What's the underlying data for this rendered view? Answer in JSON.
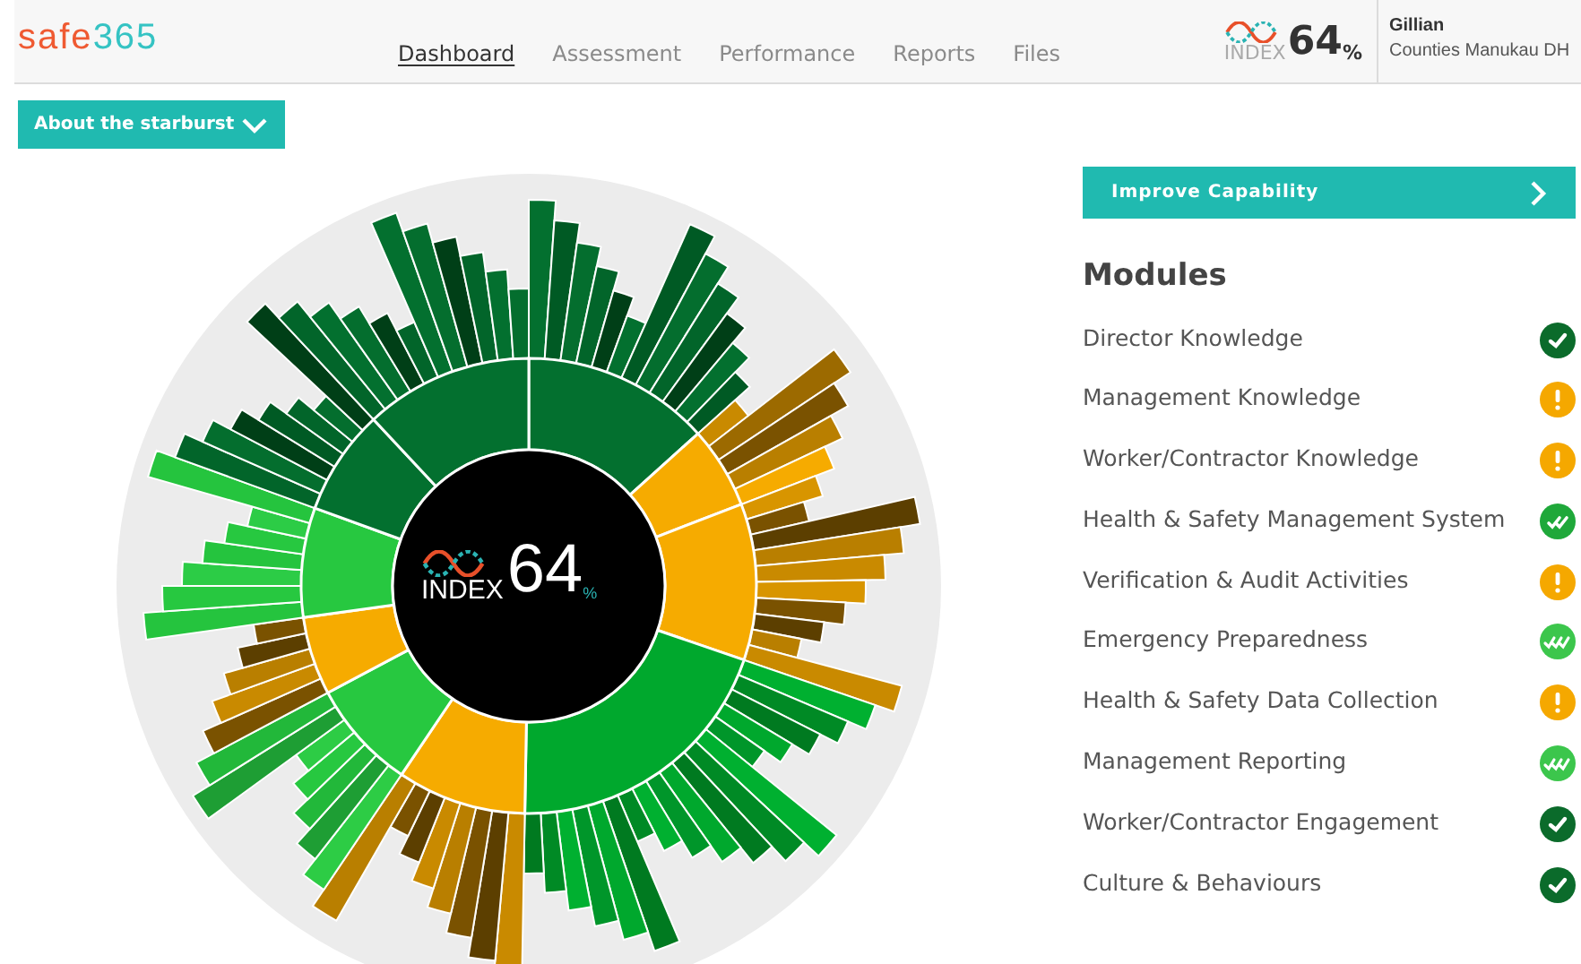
{
  "header": {
    "logo": {
      "part_1": "safe",
      "part_2": "365"
    },
    "nav": [
      {
        "label": "Dashboard",
        "selected": true
      },
      {
        "label": "Assessment",
        "selected": false
      },
      {
        "label": "Performance",
        "selected": false
      },
      {
        "label": "Reports",
        "selected": false
      },
      {
        "label": "Files",
        "selected": false
      }
    ],
    "index": {
      "label": "INDEX",
      "value": "64",
      "unit": "%"
    },
    "user": {
      "name": "Gillian",
      "organisation": "Counties Manukau DH"
    }
  },
  "about_button": {
    "label": "About the starburst"
  },
  "starburst": {
    "label": "INDEX",
    "value": "64",
    "unit": "%"
  },
  "improve_button": {
    "label": "Improve Capability"
  },
  "modules": {
    "title": "Modules",
    "items": [
      {
        "name": "Director Knowledge",
        "kind": "check"
      },
      {
        "name": "Management Knowledge",
        "kind": "warning"
      },
      {
        "name": "Worker/Contractor Knowledge",
        "kind": "warning"
      },
      {
        "name": "Health & Safety Management System",
        "kind": "double-check"
      },
      {
        "name": "Verification & Audit Activities",
        "kind": "warning"
      },
      {
        "name": "Emergency Preparedness",
        "kind": "triple-check"
      },
      {
        "name": "Health & Safety Data Collection",
        "kind": "warning"
      },
      {
        "name": "Management Reporting",
        "kind": "triple-check"
      },
      {
        "name": "Worker/Contractor Engagement",
        "kind": "check"
      },
      {
        "name": "Culture & Behaviours",
        "kind": "check"
      }
    ]
  }
}
